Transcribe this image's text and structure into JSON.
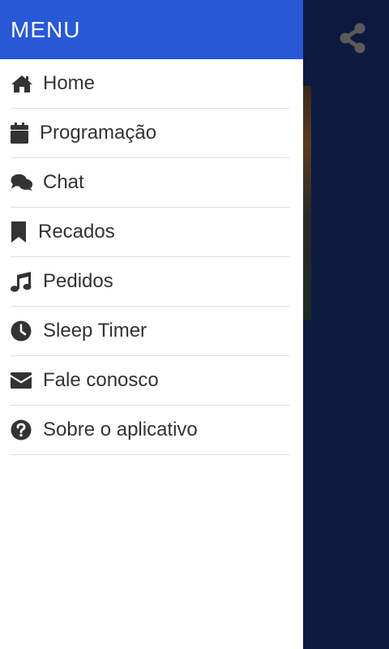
{
  "menu": {
    "title": "MENU",
    "items": [
      {
        "label": "Home",
        "icon": "home-icon"
      },
      {
        "label": "Programação",
        "icon": "calendar-icon"
      },
      {
        "label": "Chat",
        "icon": "chat-icon"
      },
      {
        "label": "Recados",
        "icon": "bookmark-icon"
      },
      {
        "label": "Pedidos",
        "icon": "music-icon"
      },
      {
        "label": "Sleep Timer",
        "icon": "clock-icon"
      },
      {
        "label": "Fale conosco",
        "icon": "envelope-icon"
      },
      {
        "label": "Sobre o aplicativo",
        "icon": "question-circle-icon"
      }
    ]
  },
  "toolbar": {
    "share_icon": "share-icon"
  },
  "colors": {
    "header": "#2758d6",
    "backdrop": "#0d1a40",
    "text": "#333333",
    "divider": "#dcdcdc"
  }
}
